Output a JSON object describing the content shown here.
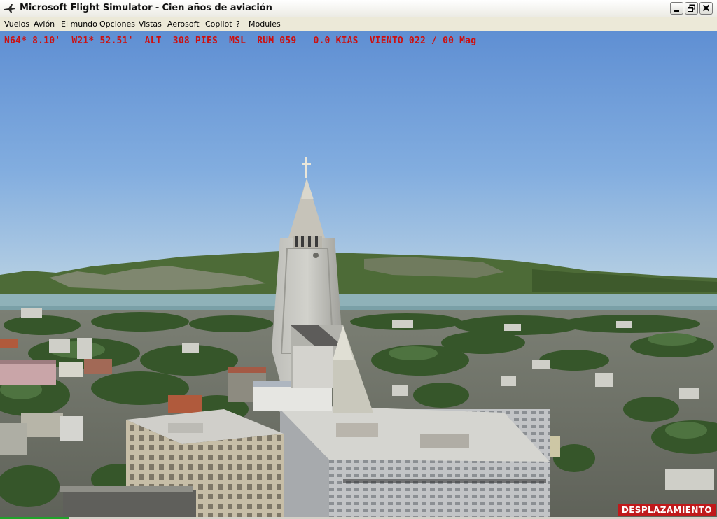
{
  "window": {
    "title": "Microsoft Flight Simulator - Cien años de aviación",
    "app_icon": "airplane-icon"
  },
  "menu": {
    "items": [
      {
        "label": "Vuelos"
      },
      {
        "label": "Avión"
      },
      {
        "label": "El mundo"
      },
      {
        "label": "Opciones"
      },
      {
        "label": "Vistas"
      },
      {
        "label": "Aerosoft"
      },
      {
        "label": "Copilot"
      },
      {
        "label": "?"
      },
      {
        "label": "Modules"
      }
    ]
  },
  "hud": {
    "text": "N64* 8.10'  W21* 52.51'  ALT  308 PIES  MSL  RUM 059   0.0 KIAS  VIENTO 022 / 00 Mag",
    "color": "#cc1010"
  },
  "status": {
    "mode_label": "DESPLAZAMIENTO",
    "badge_color": "#c0191b"
  }
}
